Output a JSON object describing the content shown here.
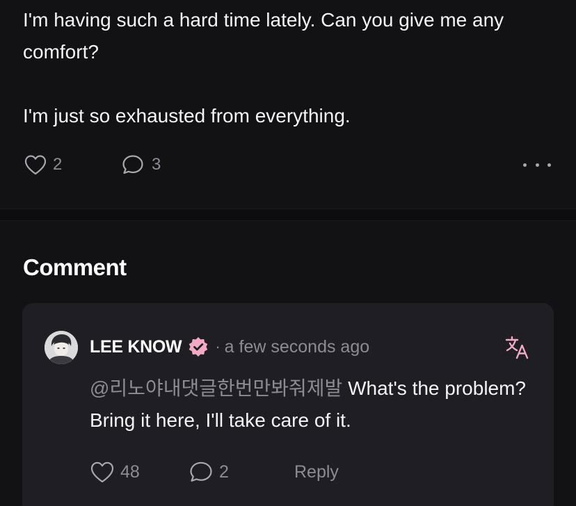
{
  "post": {
    "line1": "I'm having such a hard time lately. Can you give me any",
    "line2": "comfort?",
    "line3": "I'm just so exhausted from everything.",
    "like_count": "2",
    "comment_count": "3"
  },
  "comments_section": {
    "title": "Comment"
  },
  "comment": {
    "author": "LEE KNOW",
    "separator": "·",
    "timestamp": "a few seconds ago",
    "mention": "@리노야내댓글한번만봐줘제발",
    "text_rest": " What's the problem?",
    "text_line2": "Bring it here, I'll take care of it.",
    "like_count": "48",
    "reply_count": "2",
    "reply_label": "Reply"
  },
  "icons": {
    "like": "heart-outline-icon",
    "comment": "speech-bubble-icon",
    "more": "more-horizontal-icon",
    "verified": "verified-badge-icon",
    "translate": "translate-icon"
  },
  "colors": {
    "background": "#121114",
    "card": "#1f1e24",
    "muted_text": "#8d8b95",
    "accent_pink": "#f2a9c4"
  }
}
